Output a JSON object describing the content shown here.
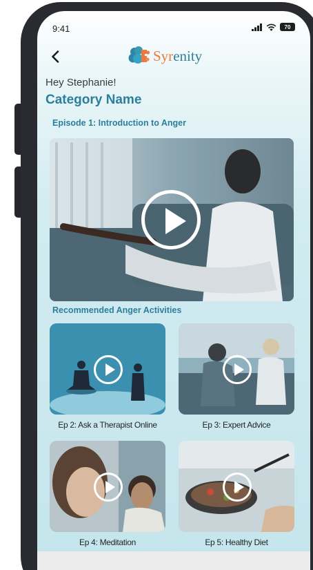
{
  "status_bar": {
    "time": "9:41",
    "battery": "70",
    "icons": [
      "signal-icon",
      "wifi-icon",
      "battery-icon"
    ]
  },
  "header": {
    "back_icon": "chevron-left-icon",
    "logo_icon": "brain-puzzle-icon",
    "logo_text_start": "Syr",
    "logo_text_end": "enity"
  },
  "greeting": "Hey Stephanie!",
  "category_title": "Category Name",
  "featured": {
    "title": "Episode 1:  Introduction to Anger",
    "play_icon": "play-icon"
  },
  "recommended": {
    "label": "Recommended Anger Activities",
    "items": [
      {
        "caption": "Ep 2: Ask a Therapist Online"
      },
      {
        "caption": "Ep 3: Expert Advice"
      },
      {
        "caption": "Ep 4: Meditation"
      },
      {
        "caption": "Ep 5: Healthy Diet"
      }
    ]
  },
  "colors": {
    "brand_teal": "#2c7f9a",
    "brand_orange": "#ea7a3f",
    "frame": "#2a2b31"
  }
}
